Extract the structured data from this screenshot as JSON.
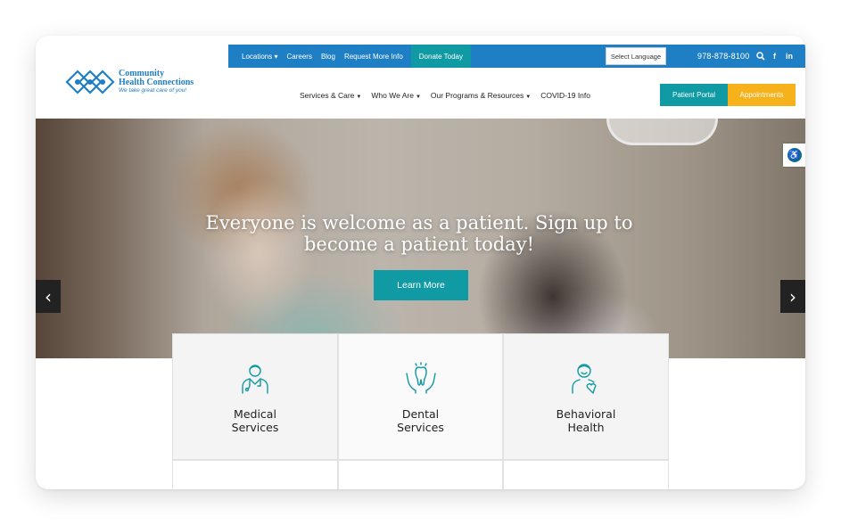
{
  "topbar": {
    "links": [
      "Locations ▾",
      "Careers",
      "Blog",
      "Request More Info"
    ],
    "donate": "Donate Today",
    "language": "Select Language",
    "phone": "978-878-8100",
    "icons": [
      "search-icon",
      "facebook-icon",
      "linkedin-icon"
    ]
  },
  "logo": {
    "line1": "Community",
    "line2": "Health Connections",
    "tagline": "We take great care of you!"
  },
  "nav": {
    "items": [
      "Services & Care",
      "Who We Are",
      "Our Programs & Resources",
      "COVID-19 Info"
    ],
    "portal": "Patient Portal",
    "appointments": "Appointments"
  },
  "hero": {
    "headline": "Everyone is welcome as a patient. Sign up to become a patient today!",
    "cta": "Learn More"
  },
  "services": [
    {
      "line1": "Medical",
      "line2": "Services",
      "icon": "doctor-icon"
    },
    {
      "line1": "Dental",
      "line2": "Services",
      "icon": "tooth-in-hands-icon"
    },
    {
      "line1": "Behavioral",
      "line2": "Health",
      "icon": "person-heart-icon"
    }
  ],
  "colors": {
    "blue": "#1f7fc4",
    "teal": "#0f9aa4",
    "gold": "#f7b21b"
  }
}
